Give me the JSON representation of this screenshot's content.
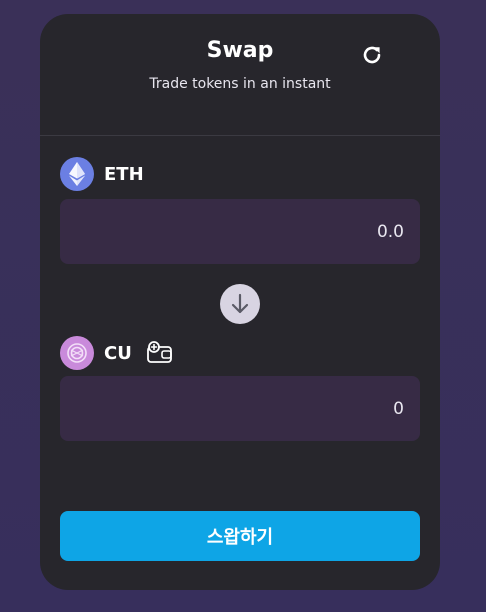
{
  "header": {
    "title": "Swap",
    "subtitle": "Trade tokens in an instant",
    "refresh_icon": "refresh-icon"
  },
  "from_token": {
    "symbol": "ETH",
    "logo_icon": "eth-logo-icon",
    "amount": "0.0"
  },
  "switch": {
    "icon": "arrow-down-icon"
  },
  "to_token": {
    "symbol": "CU",
    "logo_icon": "cu-logo-icon",
    "add_to_wallet_icon": "wallet-add-icon",
    "amount": "0"
  },
  "swap_button": {
    "label": "스왑하기"
  },
  "colors": {
    "background": "#3a3058",
    "card": "#27262c",
    "input_bg": "#372b45",
    "accent": "#0ea5e6",
    "eth_logo": "#6b7fe3",
    "cu_logo": "#c98adb"
  }
}
